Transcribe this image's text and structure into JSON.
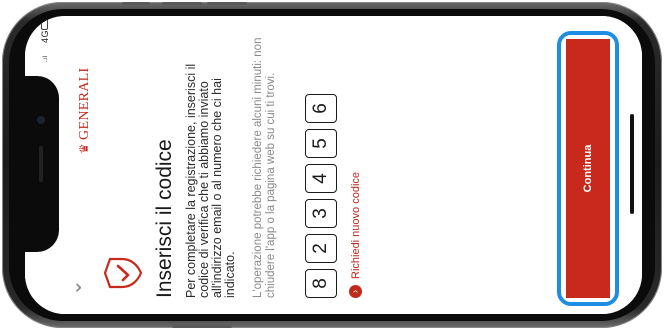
{
  "status_bar": {
    "network": "4G",
    "signal": "..ıl"
  },
  "brand": {
    "logo_text": "GENERALI",
    "accent": "#c8291c",
    "focus_color": "#1e8de4"
  },
  "header": {
    "back_icon": "chevron-down-icon",
    "shield_icon": "shield-check-icon"
  },
  "main": {
    "title": "Inserisci il codice",
    "description": "Per completare la registrazione, inserisci il codice di verifica che ti abbiamo inviato all'indirizzo email o al numero che ci hai indicato.",
    "note": "L'operazione potrebbe richiedere alcuni minuti: non chiudere l'app o la pagina web su cui ti trovi.",
    "otp_digits": [
      "8",
      "2",
      "3",
      "4",
      "5",
      "6"
    ],
    "resend_label": "Richiedi nuovo codice"
  },
  "footer": {
    "continue_label": "Continua"
  }
}
